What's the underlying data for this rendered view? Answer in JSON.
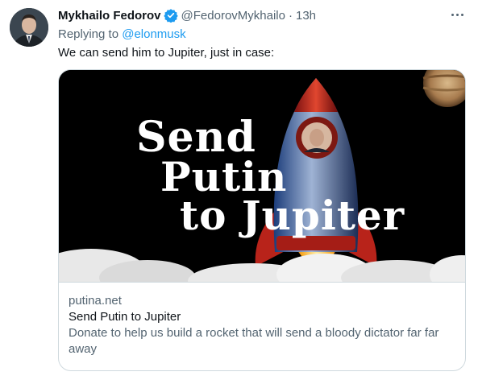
{
  "tweet": {
    "author_name": "Mykhailo Fedorov",
    "handle": "@FedorovMykhailo",
    "separator": "·",
    "time": "13h",
    "verified": true,
    "replying_prefix": "Replying to",
    "replying_to": "@elonmusk",
    "text": "We can send him to Jupiter, just in case:"
  },
  "card": {
    "image_text": {
      "line1": "Send",
      "line2": "Putin",
      "line3": "to Jupiter"
    },
    "domain": "putina.net",
    "title": "Send Putin to Jupiter",
    "description": "Donate to help us build a rocket that will send a bloody dictator far far away"
  },
  "colors": {
    "accent": "#1d9bf0",
    "secondary_text": "#536471",
    "border": "#cfd9de"
  },
  "icons": {
    "verified": "verified-badge-icon",
    "more": "more-horizontal-icon"
  }
}
